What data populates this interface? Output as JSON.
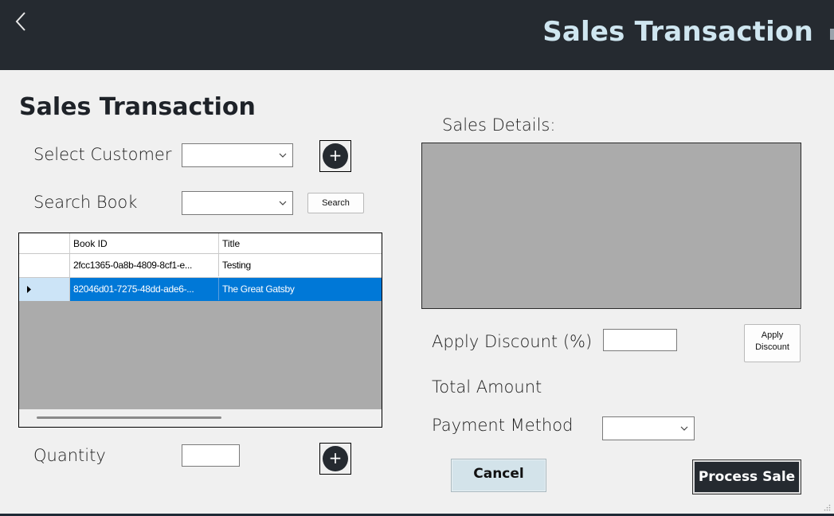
{
  "titlebar": {
    "title": "Sales Transaction",
    "back_icon": "chevron-left-icon"
  },
  "form": {
    "heading": "Sales Transaction",
    "customer": {
      "label": "Select Customer",
      "value": ""
    },
    "book_search": {
      "label": "Search Book",
      "value": "",
      "search_button": "Search"
    },
    "books_grid": {
      "columns": [
        "Book ID",
        "Title"
      ],
      "rows": [
        {
          "book_id": "2fcc1365-0a8b-4809-8cf1-e...",
          "title": "Testing",
          "selected": false
        },
        {
          "book_id": "82046d01-7275-48dd-ade6-...",
          "title": "The Great Gatsby",
          "selected": true
        }
      ]
    },
    "quantity": {
      "label": "Quantity",
      "value": ""
    }
  },
  "sales": {
    "details_label": "Sales Details:",
    "discount": {
      "label": "Apply Discount (%)",
      "value": "",
      "button_line1": "Apply",
      "button_line2": "Discount"
    },
    "total_label": "Total Amount",
    "payment": {
      "label": "Payment Method",
      "value": ""
    },
    "cancel_button": "Cancel",
    "process_button": "Process Sale"
  },
  "colors": {
    "header_bg": "#252a30",
    "title_text": "#cfe6f0",
    "selection": "#0078d7",
    "grid_bg": "#ababab"
  }
}
